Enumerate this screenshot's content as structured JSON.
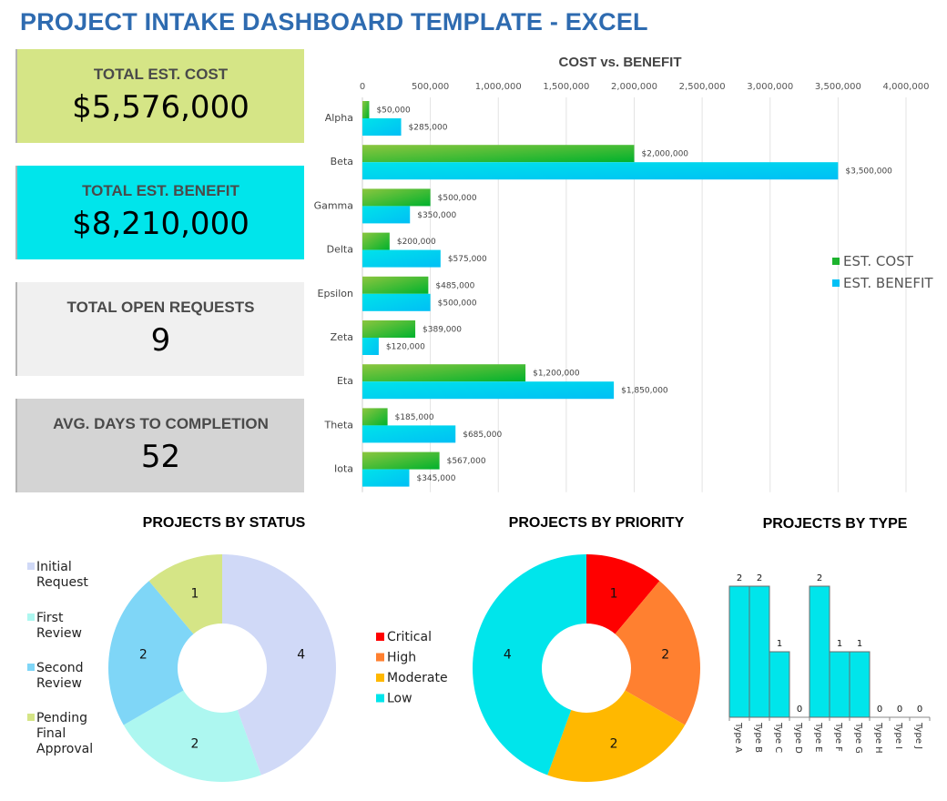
{
  "header": {
    "title": "PROJECT INTAKE DASHBOARD TEMPLATE - EXCEL"
  },
  "kpis": {
    "cost": {
      "label": "TOTAL EST. COST",
      "value": "$5,576,000",
      "color": "#d5e586"
    },
    "benefit": {
      "label": "TOTAL EST. BENEFIT",
      "value": "$8,210,000",
      "color": "#00e5eb"
    },
    "open": {
      "label": "TOTAL OPEN REQUESTS",
      "value": "9",
      "color": "#f0f0f0"
    },
    "days": {
      "label": "AVG. DAYS TO COMPLETION",
      "value": "52",
      "color": "#d4d4d4"
    }
  },
  "chart_data": [
    {
      "id": "cost_benefit",
      "type": "bar",
      "orientation": "horizontal",
      "title": "COST vs. BENEFIT",
      "categories": [
        "Alpha",
        "Beta",
        "Gamma",
        "Delta",
        "Epsilon",
        "Zeta",
        "Eta",
        "Theta",
        "Iota"
      ],
      "series": [
        {
          "name": "EST. COST",
          "color": "#1db32e",
          "color_light": "#8cc63f",
          "values": [
            50000,
            2000000,
            500000,
            200000,
            485000,
            389000,
            1200000,
            185000,
            567000
          ],
          "labels": [
            "$50,000",
            "$2,000,000",
            "$500,000",
            "$200,000",
            "$485,000",
            "$389,000",
            "$1,200,000",
            "$185,000",
            "$567,000"
          ]
        },
        {
          "name": "EST. BENEFIT",
          "color": "#00c0f5",
          "color_light": "#00e3ea",
          "values": [
            285000,
            3500000,
            350000,
            575000,
            500000,
            120000,
            1850000,
            685000,
            345000
          ],
          "labels": [
            "$285,000",
            "$3,500,000",
            "$350,000",
            "$575,000",
            "$500,000",
            "$120,000",
            "$1,850,000",
            "$685,000",
            "$345,000"
          ]
        }
      ],
      "xlim": [
        0,
        4000000
      ],
      "xticks": [
        0,
        500000,
        1000000,
        1500000,
        2000000,
        2500000,
        3000000,
        3500000,
        4000000
      ],
      "xtick_labels": [
        "0",
        "500,000",
        "1,000,000",
        "1,500,000",
        "2,000,000",
        "2,500,000",
        "3,000,000",
        "3,500,000",
        "4,000,000"
      ],
      "xaxis_position": "top",
      "grid": true,
      "legend_position": "right"
    },
    {
      "id": "status",
      "type": "pie",
      "donut": true,
      "title": "PROJECTS BY STATUS",
      "categories": [
        "Initial Request",
        "First Review",
        "Second Review",
        "Pending Final Approval"
      ],
      "legend_lines": [
        [
          "Initial",
          "Request"
        ],
        [
          "First",
          "Review"
        ],
        [
          "Second",
          "Review"
        ],
        [
          "Pending",
          "Final",
          "Approval"
        ]
      ],
      "values": [
        4,
        2,
        2,
        1
      ],
      "colors": [
        "#d0d9f7",
        "#adf7f0",
        "#7fd6f7",
        "#d5e586"
      ],
      "legend_position": "left"
    },
    {
      "id": "priority",
      "type": "pie",
      "donut": true,
      "title": "PROJECTS BY PRIORITY",
      "categories": [
        "Critical",
        "High",
        "Moderate",
        "Low"
      ],
      "values": [
        1,
        2,
        2,
        4
      ],
      "colors": [
        "#ff0000",
        "#ff8030",
        "#ffb800",
        "#00e5eb"
      ],
      "legend_position": "left"
    },
    {
      "id": "type",
      "type": "bar",
      "orientation": "vertical",
      "title": "PROJECTS BY TYPE",
      "categories": [
        "Type A",
        "Type B",
        "Type C",
        "Type D",
        "Type E",
        "Type F",
        "Type G",
        "Type H",
        "Type I",
        "Type J"
      ],
      "values": [
        2,
        2,
        1,
        0,
        2,
        1,
        1,
        0,
        0,
        0
      ],
      "color": "#00e5eb",
      "ylim": [
        0,
        2
      ],
      "grid": false
    }
  ]
}
